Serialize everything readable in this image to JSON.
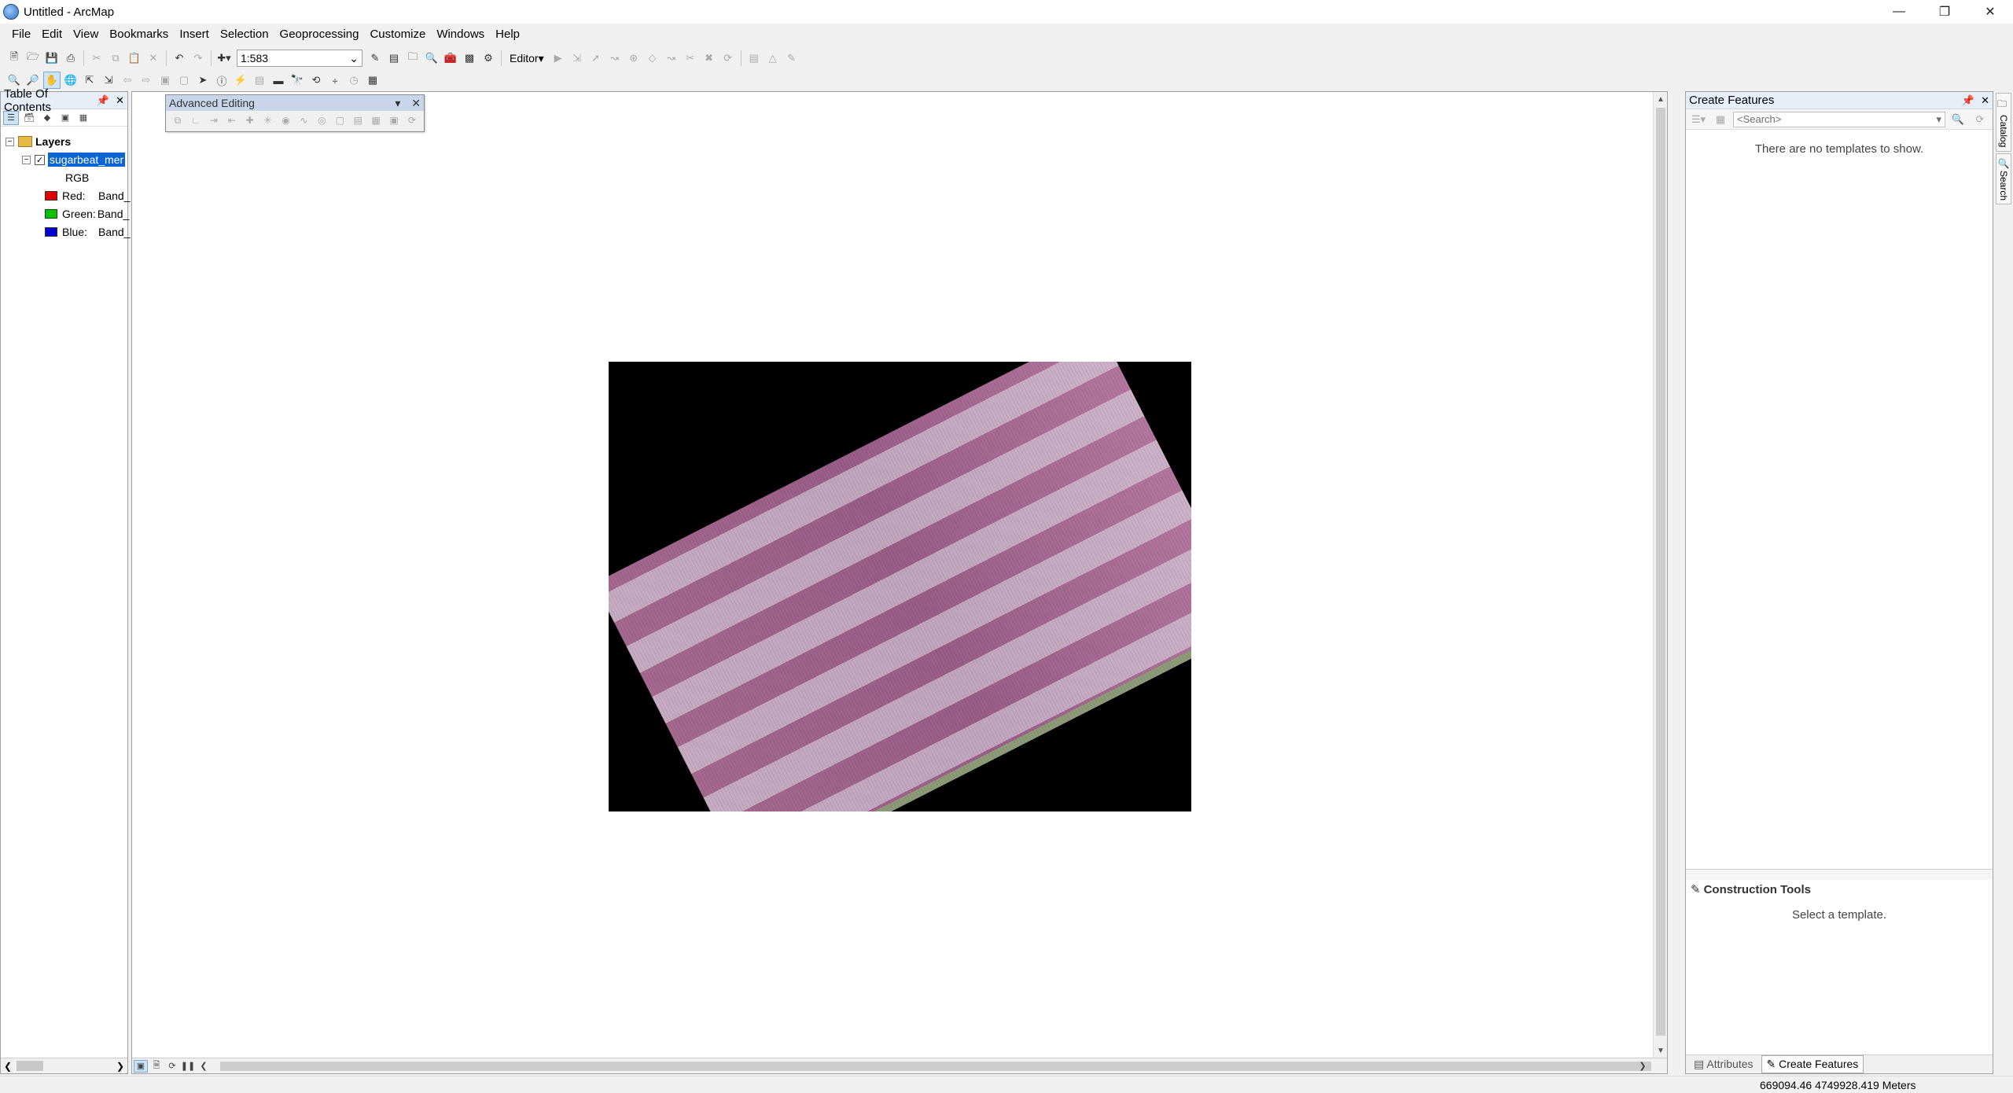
{
  "window": {
    "title": "Untitled - ArcMap",
    "controls": [
      "minimize-icon",
      "restore-icon",
      "close-icon"
    ]
  },
  "menu": [
    "File",
    "Edit",
    "View",
    "Bookmarks",
    "Insert",
    "Selection",
    "Geoprocessing",
    "Customize",
    "Windows",
    "Help"
  ],
  "toolbar": {
    "scale_value": "1:583",
    "editor_label": "Editor"
  },
  "toc": {
    "title": "Table Of Contents",
    "root_label": "Layers",
    "layer_name": "sugarbeat_mer",
    "layer_checked": true,
    "renderer_label": "RGB",
    "bands": [
      {
        "channel": "Red:",
        "band": "Band_",
        "color": "#e00000"
      },
      {
        "channel": "Green:",
        "band": "Band_",
        "color": "#00c000"
      },
      {
        "channel": "Blue:",
        "band": "Band_",
        "color": "#0000d0"
      }
    ]
  },
  "advanced_editing": {
    "title": "Advanced Editing"
  },
  "create_features": {
    "title": "Create Features",
    "search_placeholder": "<Search>",
    "empty_message": "There are no templates to show.",
    "construction_tools_title": "Construction Tools",
    "construction_tools_message": "Select a template.",
    "tabs": [
      "Attributes",
      "Create Features"
    ],
    "active_tab": "Create Features"
  },
  "side_tabs": [
    "Catalog",
    "Search"
  ],
  "status": {
    "coordinates": "669094.46  4749928.419 Meters"
  }
}
